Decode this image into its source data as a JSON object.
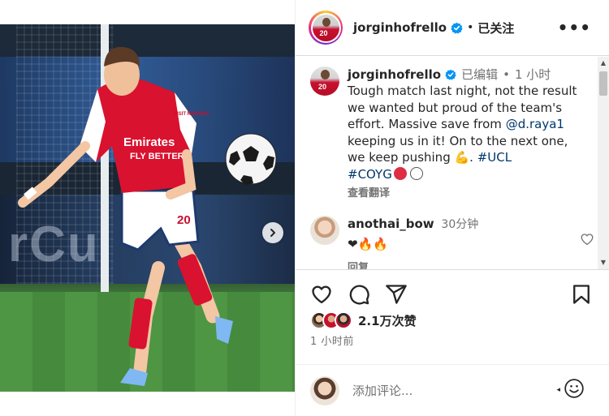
{
  "post": {
    "username": "jorginhofrello",
    "follow_state": "已关注",
    "more": "•••",
    "jersey_number": "20",
    "sponsor_line1": "Emirates",
    "sponsor_line2": "FLY BETTER",
    "sleeve_text": "VISIT RWANDA"
  },
  "caption": {
    "username": "jorginhofrello",
    "edited": "已编辑",
    "separator": "•",
    "time": "1 小时",
    "text_before": "Tough match last night, not the result we wanted but proud of the team's effort. Massive save from ",
    "mention": "@d.raya1",
    "text_after": " keeping us in it! On to the next one, we keep pushing ",
    "emoji_flex": "💪",
    "after_emoji": ". ",
    "tag1": "#UCL",
    "tag2": "#COYG",
    "see_translation": "查看翻译"
  },
  "comment": {
    "username": "anothai_bow",
    "time": "30分钟",
    "text": "❤🔥🔥",
    "reply": "回复"
  },
  "likes": {
    "text": "2.1万次赞",
    "time": "1 小时前"
  },
  "add_comment": {
    "placeholder": "添加评论..."
  },
  "icons": [
    "verified-icon",
    "more-icon",
    "heart-icon",
    "comment-icon",
    "share-icon",
    "save-icon",
    "emoji-icon",
    "chevron-right-icon"
  ],
  "colors": {
    "accent_blue": "#0095f6",
    "link": "#00376b",
    "muted": "#737373",
    "arsenal_red": "#c8102e"
  }
}
